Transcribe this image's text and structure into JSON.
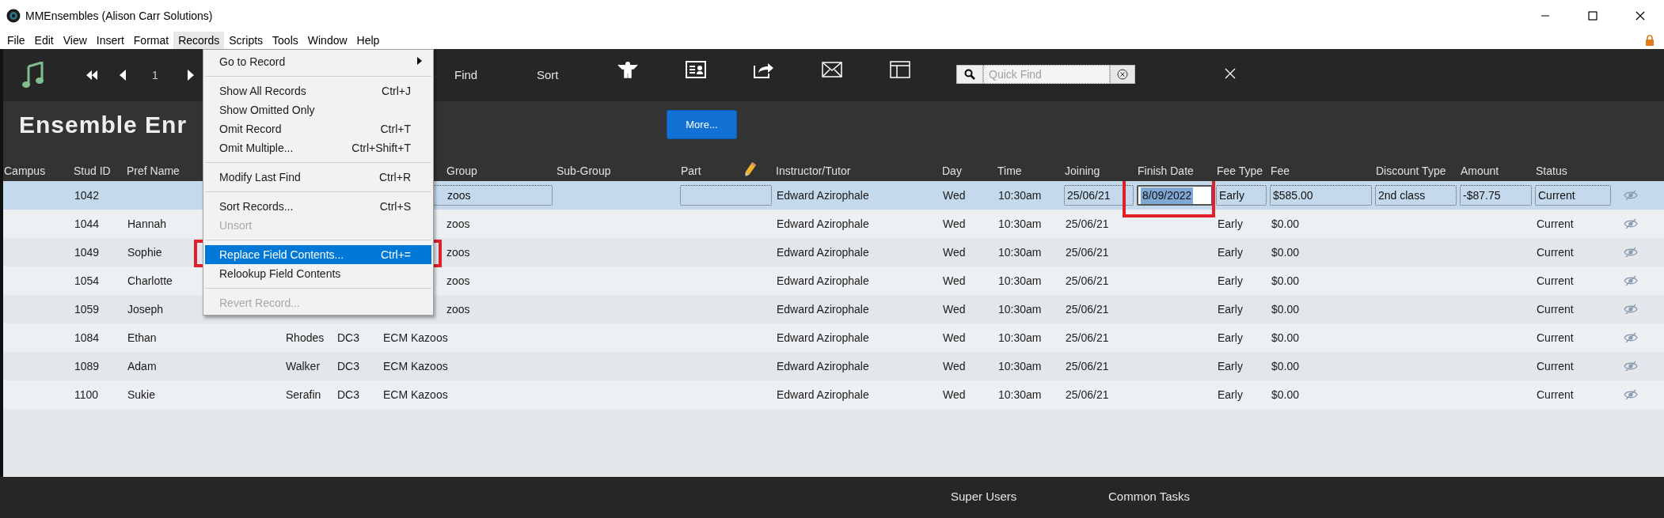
{
  "window": {
    "title": "MMEnsembles (Alison Carr Solutions)"
  },
  "menu_bar": [
    {
      "label": "File",
      "selected": false
    },
    {
      "label": "Edit",
      "selected": false
    },
    {
      "label": "View",
      "selected": false
    },
    {
      "label": "Insert",
      "selected": false
    },
    {
      "label": "Format",
      "selected": false
    },
    {
      "label": "Records",
      "selected": true
    },
    {
      "label": "Scripts",
      "selected": false
    },
    {
      "label": "Tools",
      "selected": false
    },
    {
      "label": "Window",
      "selected": false
    },
    {
      "label": "Help",
      "selected": false
    }
  ],
  "open_menu": {
    "items": [
      {
        "kind": "item",
        "label": "Go to Record",
        "submenu": true,
        "disabled": false,
        "selected": false
      },
      {
        "kind": "separator"
      },
      {
        "kind": "item",
        "label": "Show All Records",
        "shortcut": "Ctrl+J",
        "disabled": false,
        "selected": false
      },
      {
        "kind": "item",
        "label": "Show Omitted Only",
        "disabled": false,
        "selected": false
      },
      {
        "kind": "item",
        "label": "Omit Record",
        "shortcut": "Ctrl+T",
        "disabled": false,
        "selected": false
      },
      {
        "kind": "item",
        "label": "Omit Multiple...",
        "shortcut": "Ctrl+Shift+T",
        "disabled": false,
        "selected": false
      },
      {
        "kind": "separator"
      },
      {
        "kind": "item",
        "label": "Modify Last Find",
        "shortcut": "Ctrl+R",
        "disabled": false,
        "selected": false
      },
      {
        "kind": "separator"
      },
      {
        "kind": "item",
        "label": "Sort Records...",
        "shortcut": "Ctrl+S",
        "disabled": false,
        "selected": false
      },
      {
        "kind": "item",
        "label": "Unsort",
        "disabled": true,
        "selected": false
      },
      {
        "kind": "separator"
      },
      {
        "kind": "item",
        "label": "Replace Field Contents...",
        "shortcut": "Ctrl+=",
        "disabled": false,
        "selected": true,
        "annotated": true
      },
      {
        "kind": "item",
        "label": "Relookup Field Contents",
        "disabled": false,
        "selected": false
      },
      {
        "kind": "separator"
      },
      {
        "kind": "item",
        "label": "Revert Record...",
        "disabled": true,
        "selected": false
      }
    ]
  },
  "toolbar": {
    "record_number": "1",
    "text_buttons": [
      "Find",
      "Sort"
    ],
    "quick_find": {
      "placeholder": "Quick Find"
    }
  },
  "layout": {
    "title": "Ensemble Enr",
    "more_button": "More..."
  },
  "table": {
    "columns": [
      {
        "label": "Campus"
      },
      {
        "label": "Stud ID"
      },
      {
        "label": "Pref Name"
      },
      {},
      {},
      {
        "label": "Group",
        "cut": true
      },
      {
        "label": "Sub-Group"
      },
      {
        "label": "Part",
        "edit_icon": true
      },
      {
        "label": "Instructor/Tutor"
      },
      {
        "label": "Day"
      },
      {
        "label": "Time"
      },
      {
        "label": "Joining"
      },
      {
        "label": "Finish Date",
        "annotated": true
      },
      {
        "label": "Fee Type"
      },
      {
        "label": "Fee"
      },
      {
        "label": "Discount Type"
      },
      {
        "label": "Amount"
      },
      {
        "label": "Status"
      }
    ],
    "rows": [
      {
        "selected": true,
        "cells": [
          null,
          "1042",
          null,
          null,
          null,
          {
            "text": "zoos",
            "cut": true
          },
          null,
          null,
          "Edward Azirophale",
          "Wed",
          "10:30am",
          "25/06/21",
          {
            "text": "8/09/2022",
            "focused": true
          },
          "Early",
          "$585.00",
          "2nd class",
          "-$87.75",
          "Current"
        ]
      },
      {
        "selected": false,
        "cells": [
          null,
          "1044",
          "Hannah",
          null,
          null,
          {
            "text": "zoos",
            "cut": true
          },
          null,
          null,
          "Edward Azirophale",
          "Wed",
          "10:30am",
          "25/06/21",
          null,
          "Early",
          "$0.00",
          null,
          null,
          "Current"
        ]
      },
      {
        "selected": false,
        "cells": [
          null,
          "1049",
          "Sophie",
          null,
          null,
          {
            "text": "zoos",
            "cut": true
          },
          null,
          null,
          "Edward Azirophale",
          "Wed",
          "10:30am",
          "25/06/21",
          null,
          "Early",
          "$0.00",
          null,
          null,
          "Current"
        ]
      },
      {
        "selected": false,
        "cells": [
          null,
          "1054",
          "Charlotte",
          null,
          null,
          {
            "text": "zoos",
            "cut": true
          },
          null,
          null,
          "Edward Azirophale",
          "Wed",
          "10:30am",
          "25/06/21",
          null,
          "Early",
          "$0.00",
          null,
          null,
          "Current"
        ]
      },
      {
        "selected": false,
        "cells": [
          null,
          "1059",
          "Joseph",
          null,
          null,
          {
            "text": "zoos",
            "cut": true
          },
          null,
          null,
          "Edward Azirophale",
          "Wed",
          "10:30am",
          "25/06/21",
          null,
          "Early",
          "$0.00",
          null,
          null,
          "Current"
        ]
      },
      {
        "selected": false,
        "cells": [
          null,
          "1084",
          "Ethan",
          "Rhodes",
          "DC3",
          "ECM Kazoos",
          null,
          null,
          "Edward Azirophale",
          "Wed",
          "10:30am",
          "25/06/21",
          null,
          "Early",
          "$0.00",
          null,
          null,
          "Current"
        ]
      },
      {
        "selected": false,
        "cells": [
          null,
          "1089",
          "Adam",
          "Walker",
          "DC3",
          "ECM Kazoos",
          null,
          null,
          "Edward Azirophale",
          "Wed",
          "10:30am",
          "25/06/21",
          null,
          "Early",
          "$0.00",
          null,
          null,
          "Current"
        ]
      },
      {
        "selected": false,
        "cells": [
          null,
          "1100",
          "Sukie",
          "Serafin",
          "DC3",
          "ECM Kazoos",
          null,
          null,
          "Edward Azirophale",
          "Wed",
          "10:30am",
          "25/06/21",
          null,
          "Early",
          "$0.00",
          null,
          null,
          "Current"
        ]
      }
    ]
  },
  "footer": [
    "Super Users",
    "Common Tasks"
  ]
}
